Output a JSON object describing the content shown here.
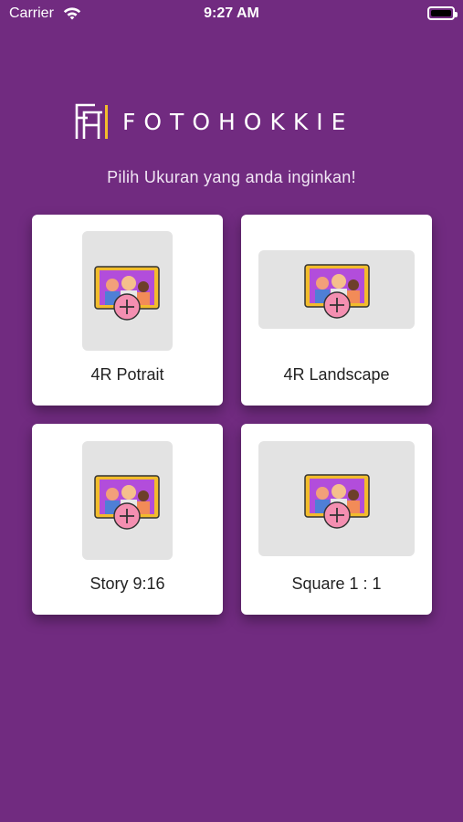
{
  "status_bar": {
    "carrier": "Carrier",
    "time": "9:27 AM"
  },
  "header": {
    "logo_text": "FOTOHOKKIE",
    "subtitle": "Pilih Ukuran yang anda inginkan!"
  },
  "options": [
    {
      "label": "4R Potrait",
      "orientation": "portrait"
    },
    {
      "label": "4R Landscape",
      "orientation": "landscape"
    },
    {
      "label": "Story 9:16",
      "orientation": "portrait"
    },
    {
      "label": "Square 1 : 1",
      "orientation": "landscape"
    }
  ],
  "colors": {
    "background": "#712B80",
    "card": "#FFFFFF",
    "placeholder": "#E3E3E3",
    "frame": "#F2BC2C",
    "add_badge": "#F48FB1"
  },
  "icons": {
    "add": "add-photo-icon",
    "wifi": "wifi-icon",
    "battery": "battery-icon"
  }
}
